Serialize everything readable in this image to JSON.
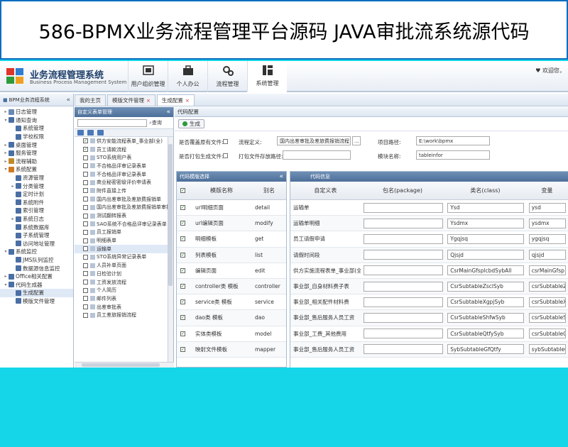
{
  "banner": {
    "title": "586-BPMX业务流程管理平台源码 JAVA审批流系统源代码"
  },
  "header": {
    "app_title": "业务流程管理系统",
    "app_subtitle": "Business Process Management System",
    "welcome": "欢迎您，",
    "nav": [
      {
        "label": "用户组织管理",
        "icon": "org-icon"
      },
      {
        "label": "个人办公",
        "icon": "briefcase-icon"
      },
      {
        "label": "流程管理",
        "icon": "gears-icon"
      },
      {
        "label": "系统管理",
        "icon": "system-icon"
      }
    ]
  },
  "sidebar": {
    "title": "BPM业务流程系统",
    "items": [
      {
        "label": "日志管理",
        "level": 0,
        "arrow": "▸",
        "color": "#6a8ab5"
      },
      {
        "label": "通知查询",
        "level": 0,
        "arrow": "▾",
        "color": "#4a6fa5"
      },
      {
        "label": "系统管理",
        "level": 1,
        "arrow": "",
        "color": "#4a6fa5"
      },
      {
        "label": "学校权限",
        "level": 1,
        "arrow": "",
        "color": "#4a6fa5"
      },
      {
        "label": "桌面管理",
        "level": 0,
        "arrow": "▸",
        "color": "#4a6fa5"
      },
      {
        "label": "服务管理",
        "level": 0,
        "arrow": "▸",
        "color": "#4a6fa5"
      },
      {
        "label": "流程辅助",
        "level": 0,
        "arrow": "▸",
        "color": "#c08a2a"
      },
      {
        "label": "系统配置",
        "level": 0,
        "arrow": "▾",
        "color": "#d07a20"
      },
      {
        "label": "资源管理",
        "level": 1,
        "arrow": "",
        "color": "#4a6fa5"
      },
      {
        "label": "分类管理",
        "level": 1,
        "arrow": "▸",
        "color": "#4a6fa5"
      },
      {
        "label": "定时计划",
        "level": 1,
        "arrow": "",
        "color": "#4a6fa5"
      },
      {
        "label": "系统附件",
        "level": 1,
        "arrow": "",
        "color": "#4a6fa5"
      },
      {
        "label": "索引管理",
        "level": 1,
        "arrow": "",
        "color": "#4a6fa5"
      },
      {
        "label": "系统日志",
        "level": 1,
        "arrow": "▸",
        "color": "#4a6fa5"
      },
      {
        "label": "系统数据库",
        "level": 1,
        "arrow": "",
        "color": "#4a6fa5"
      },
      {
        "label": "子系统管理",
        "level": 1,
        "arrow": "",
        "color": "#4a6fa5"
      },
      {
        "label": "访问地址管理",
        "level": 1,
        "arrow": "",
        "color": "#4a6fa5"
      },
      {
        "label": "系统监控",
        "level": 0,
        "arrow": "▾",
        "color": "#4a6fa5"
      },
      {
        "label": "JMS队列监控",
        "level": 1,
        "arrow": "",
        "color": "#4a6fa5"
      },
      {
        "label": "数据源信息监控",
        "level": 1,
        "arrow": "",
        "color": "#4a6fa5"
      },
      {
        "label": "Office相关配置",
        "level": 0,
        "arrow": "▸",
        "color": "#4a6fa5"
      },
      {
        "label": "代码生成器",
        "level": 0,
        "arrow": "▾",
        "color": "#4a6fa5"
      },
      {
        "label": "生成配置",
        "level": 1,
        "arrow": "",
        "color": "#4a6fa5",
        "selected": true
      },
      {
        "label": "模版文件管理",
        "level": 1,
        "arrow": "",
        "color": "#4a6fa5"
      }
    ]
  },
  "tabs": [
    {
      "label": "我的主页",
      "active": false
    },
    {
      "label": "模版文件管理",
      "active": false
    },
    {
      "label": "生成配置",
      "active": true
    }
  ],
  "form_list": {
    "title": "自定义表单管理",
    "search_label": "查询",
    "items": [
      {
        "label": "供方安能流程表单_事业部(全)",
        "checked": true
      },
      {
        "label": "员工请款流程",
        "checked": true
      },
      {
        "label": "STO系统用户表",
        "checked": false
      },
      {
        "label": "不合格品评审记录表单",
        "checked": false
      },
      {
        "label": "不合格品评审记录表单",
        "checked": false
      },
      {
        "label": "商业秘密密级评价申请表",
        "checked": false
      },
      {
        "label": "附件直接上传",
        "checked": false
      },
      {
        "label": "国内出差审批及差旅费报销单",
        "checked": false
      },
      {
        "label": "国内出差审批及差旅费报销单审批",
        "checked": false
      },
      {
        "label": "测试翻转报表",
        "checked": false
      },
      {
        "label": "SAO系统不合格品评审记录表单",
        "checked": false
      },
      {
        "label": "员工报销单",
        "checked": false
      },
      {
        "label": "明细表单",
        "checked": false
      },
      {
        "label": "运输单",
        "checked": false,
        "selected": true
      },
      {
        "label": "STO系统异常记录表单",
        "checked": false
      },
      {
        "label": "人员补单页面",
        "checked": false
      },
      {
        "label": "日检验计划",
        "checked": false
      },
      {
        "label": "工资发放流程",
        "checked": false
      },
      {
        "label": "个人简历",
        "checked": false
      },
      {
        "label": "邮件列表",
        "checked": false
      },
      {
        "label": "出差审批表",
        "checked": false
      },
      {
        "label": "员工差旅报销流程",
        "checked": false
      }
    ]
  },
  "config": {
    "title": "代码配置",
    "generate_label": "生成",
    "overwrite_label": "是否覆盖原有文件:",
    "flow_def_label": "流程定义:",
    "flow_def_value": "国内出差审批及差旅费报销流程",
    "flow_def_btn": "...",
    "project_path_label": "项目路径:",
    "project_path_value": "E:\\work\\bpmx",
    "pack_label": "是否打包生成文件:",
    "pack_path_label": "打包文件存放路径:",
    "module_label": "模块名称:",
    "module_value": "tableinfor"
  },
  "templates": {
    "title": "代码模版选择",
    "col_name": "模版名称",
    "col_alias": "别名",
    "rows": [
      {
        "name": "url明细页面",
        "alias": "detail"
      },
      {
        "name": "url编辑页面",
        "alias": "modify"
      },
      {
        "name": "明细模板",
        "alias": "get"
      },
      {
        "name": "列表模板",
        "alias": "list"
      },
      {
        "name": "编辑页面",
        "alias": "edit"
      },
      {
        "name": "controller类 模板",
        "alias": "controller"
      },
      {
        "name": "service类 模板",
        "alias": "service"
      },
      {
        "name": "dao类 模板",
        "alias": "dao"
      },
      {
        "name": "实体类模板",
        "alias": "model"
      },
      {
        "name": "映射文件模板",
        "alias": "mapper"
      }
    ]
  },
  "code_info": {
    "title": "代码信息",
    "col_table": "自定义表",
    "col_package": "包名(package)",
    "col_class": "类名(class)",
    "col_var": "变量",
    "rows": [
      {
        "table": "运输单",
        "package": "",
        "class": "Ysd",
        "var": "ysd"
      },
      {
        "table": "运输单明细",
        "package": "",
        "class": "Ysdmx",
        "var": "ysdmx"
      },
      {
        "table": "员工请假申请",
        "package": "",
        "class": "Ygqjsq",
        "var": "ygqjsq"
      },
      {
        "table": "请假时间段",
        "package": "",
        "class": "Qjsjd",
        "var": "qjsjd"
      },
      {
        "table": "供方实施流程表单_事业部(全)",
        "package": "",
        "class": "CsrMainGfsplcbdSybAll",
        "var": "csrMainGfsp"
      },
      {
        "table": "事业部_自身材料费子表",
        "package": "",
        "class": "CsrSubtableZsclSyb",
        "var": "csrSubtableZ"
      },
      {
        "table": "事业部_相关配件材料费",
        "package": "",
        "class": "CsrSubtableXgpjSyb",
        "var": "csrSubtableX"
      },
      {
        "table": "事业部_售后服务人员工资",
        "package": "",
        "class": "CsrSubtableShfwSyb",
        "var": "csrSubtableS"
      },
      {
        "table": "事业部_工费_其他费用",
        "package": "",
        "class": "CsrSubtableQtfySyb",
        "var": "csrSubtableQ"
      },
      {
        "table": "事业部_售后服务人员工资",
        "package": "",
        "class": "SybSubtableGfQtfy",
        "var": "sybSubtableG"
      }
    ]
  }
}
